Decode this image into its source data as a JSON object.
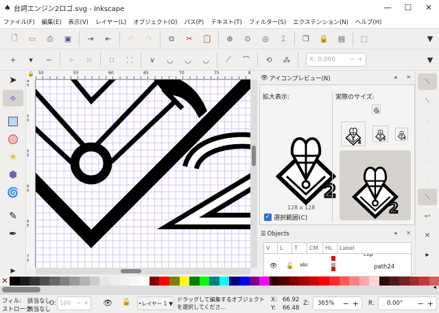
{
  "window": {
    "title": "台詞エンジン2ロゴ.svg - Inkscape",
    "minimize": "—",
    "maximize": "☐",
    "close": "✕"
  },
  "menu": [
    "ファイル(F)",
    "編集(E)",
    "表示(V)",
    "レイヤー(L)",
    "オブジェクト(O)",
    "パス(P)",
    "テキスト(T)",
    "フィルター(S)",
    "エクステンション(N)",
    "ヘルプ(H)"
  ],
  "node_toolbar": {
    "x_label": "X:",
    "x_value": "0.000",
    "minus": "−",
    "plus": "+"
  },
  "rulers": {
    "h_ticks": [
      "50",
      "55",
      "60",
      "65",
      "70",
      "75",
      "8"
    ],
    "v_ticks": [
      "45",
      "50",
      "55",
      "60",
      "65",
      "70"
    ]
  },
  "icon_preview": {
    "title": "アイコンプレビュー(N)",
    "magnified_label": "拡大表示:",
    "actual_size_label": "実際のサイズ:",
    "size": "128 x 128",
    "selection_checkbox": "選択範囲(C)",
    "selection_checked": true
  },
  "objects": {
    "title": "Objects",
    "columns": [
      "V",
      "L",
      "T",
      "CM",
      "HL",
      "Label"
    ],
    "rows": [
      {
        "label": "clip"
      },
      {
        "label": "path24"
      }
    ]
  },
  "palette": [
    "#000000",
    "#1a1a1a",
    "#333333",
    "#4d4d4d",
    "#666666",
    "#808080",
    "#999999",
    "#b3b3b3",
    "#cccccc",
    "#e6e6e6",
    "#ececec",
    "#f2f2f2",
    "#f8f8f8",
    "#ffffff",
    "#800000",
    "#ff0000",
    "#808000",
    "#ffff00",
    "#008000",
    "#00ff00",
    "#008080",
    "#00ffff",
    "#000080",
    "#0000ff",
    "#800080",
    "#ff00ff",
    "#2b0000",
    "#550000",
    "#800000",
    "#aa0000",
    "#d40000",
    "#ff0000",
    "#ff2a2a",
    "#ff5555",
    "#ff8080",
    "#ffaaaa",
    "#ffd5d5",
    "#280b0b",
    "#501616",
    "#782121",
    "#a02c2c",
    "#c83737",
    "#d35f5f"
  ],
  "status": {
    "fill_label": "フィル:",
    "fill_value": "該当なし",
    "stroke_label": "ストローク:",
    "stroke_value": "該当なし",
    "opacity_label": "O:",
    "opacity_value": "100",
    "layer": "•レイヤー 1",
    "message": "ドラッグして編集するオブジェクトを選択してくださ...",
    "x_label": "X:",
    "x_value": "66.92",
    "y_label": "Y:",
    "y_value": "66.48",
    "zoom_label": "Z:",
    "zoom_value": "365%",
    "rotation_label": "R:",
    "rotation_value": "0.00°",
    "minus": "−",
    "plus": "+"
  }
}
